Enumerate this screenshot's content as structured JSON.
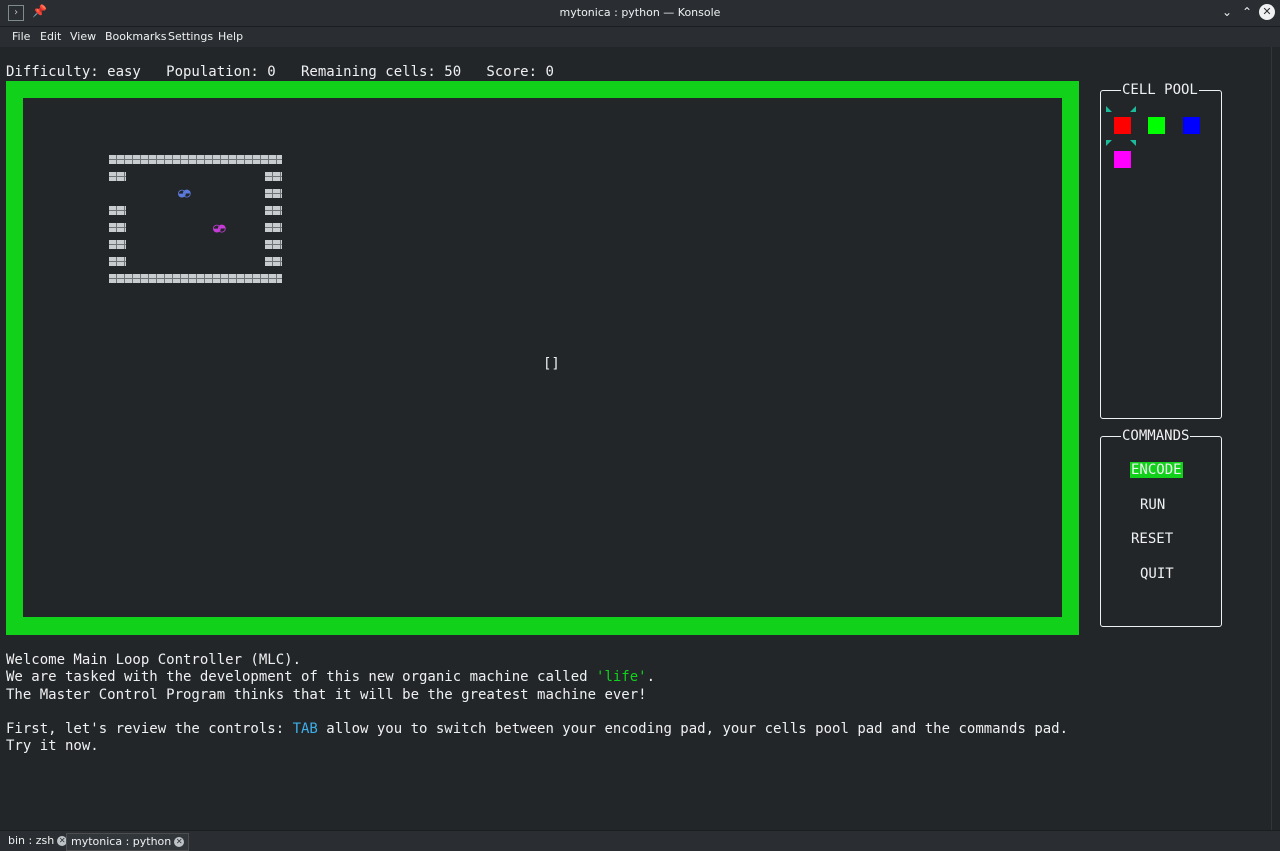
{
  "window": {
    "title": "mytonica : python — Konsole",
    "app_icon": "terminal-icon",
    "pin_icon": "pin-icon"
  },
  "menu": [
    "File",
    "Edit",
    "View",
    "Bookmarks",
    "Settings",
    "Help"
  ],
  "status": {
    "text": "Difficulty: easy   Population: 0   Remaining cells: 50   Score: 0"
  },
  "encoding_pad": {
    "border_color": "#11d11a",
    "cursor": "[]"
  },
  "cell_pool": {
    "title": "CELL POOL",
    "cells": [
      {
        "color": "#ff0000",
        "selected": true
      },
      {
        "color": "#00ff00",
        "selected": false
      },
      {
        "color": "#0000ff",
        "selected": false
      },
      {
        "color": "#ff00ff",
        "selected": false
      }
    ],
    "selector_color": "#1abc9c"
  },
  "commands": {
    "title": "COMMANDS",
    "items": [
      "ENCODE",
      "RUN",
      "RESET",
      "QUIT"
    ],
    "active": "ENCODE",
    "active_color": "#11d11a"
  },
  "messages": {
    "line1": "Welcome Main Loop Controller (MLC).",
    "line2_pre": "We are tasked with the development of this new organic machine called ",
    "line2_hl": "'life'",
    "line2_post": ".",
    "line3": "The Master Control Program thinks that it will be the greatest machine ever!",
    "line5_pre": "First, let's review the controls: ",
    "line5_hl": "TAB",
    "line5_post": " allow you to switch between your encoding pad, your cells pool pad and the commands pad.",
    "line6": "Try it now."
  },
  "tabs": [
    {
      "label": "bin : zsh",
      "active": false
    },
    {
      "label": "mytonica : python",
      "active": true
    }
  ]
}
